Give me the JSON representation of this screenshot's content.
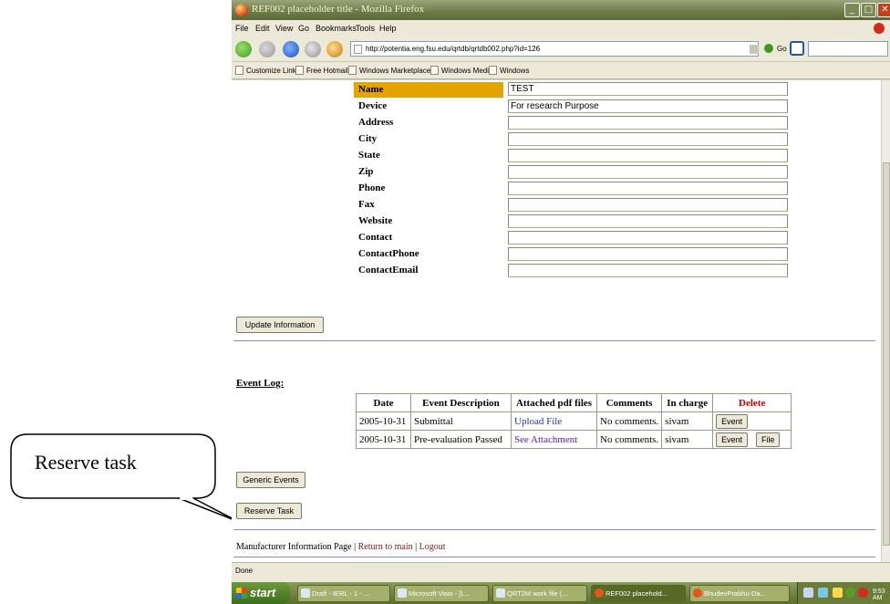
{
  "callout": {
    "text": "Reserve task"
  },
  "window": {
    "title": "REF002 placeholder title - Mozilla Firefox",
    "controls": {
      "minimize": "_",
      "maximize": "□",
      "close": "✕"
    }
  },
  "menu": [
    "File",
    "Edit",
    "View",
    "Go",
    "Bookmarks",
    "Tools",
    "Help"
  ],
  "nav": {
    "url": "http://potentia.eng.fsu.edu/qrtdb/qrtdb002.php?id=126",
    "go_label": "Go"
  },
  "bookmarks": [
    "Customize Links",
    "Free Hotmail",
    "Windows Marketplace",
    "Windows Media",
    "Windows"
  ],
  "info": {
    "fields": [
      {
        "label": "Name",
        "value": "TEST"
      },
      {
        "label": "Device",
        "value": "For research Purpose"
      },
      {
        "label": "Address",
        "value": ""
      },
      {
        "label": "City",
        "value": ""
      },
      {
        "label": "State",
        "value": ""
      },
      {
        "label": "Zip",
        "value": ""
      },
      {
        "label": "Phone",
        "value": ""
      },
      {
        "label": "Fax",
        "value": ""
      },
      {
        "label": "Website",
        "value": ""
      },
      {
        "label": "Contact",
        "value": ""
      },
      {
        "label": "ContactPhone",
        "value": ""
      },
      {
        "label": "ContactEmail",
        "value": ""
      }
    ],
    "update_button": "Update Information"
  },
  "event_log": {
    "title": "Event Log:",
    "headers": [
      "Date",
      "Event Description",
      "Attached pdf files",
      "Comments",
      "In charge",
      "Delete"
    ],
    "rows": [
      {
        "date": "2005-10-31",
        "description": "Submittal",
        "attachment": "Upload File",
        "comments": "No comments.",
        "in_charge": "sivam",
        "event_button": "Event",
        "file_button": ""
      },
      {
        "date": "2005-10-31",
        "description": "Pre-evaluation Passed",
        "attachment": "See Attachment",
        "comments": "No comments.",
        "in_charge": "sivam",
        "event_button": "Event",
        "file_button": "File"
      }
    ]
  },
  "buttons": {
    "generic_events": "Generic Events",
    "reserve_task": "Reserve Task"
  },
  "footer": {
    "page_name": "Manufacturer Information Page",
    "sep": "|",
    "return_main": "Return to main",
    "logout": "Logout"
  },
  "status": "Done",
  "taskbar": {
    "start": "start",
    "items": [
      "Draft - IERL - 1 - ...",
      "Microsoft Visio - [L...",
      "QRT2M work file (...",
      "REF002 placehold...",
      "BhudevPrabhu-Da..."
    ],
    "clock": "9:53 AM"
  }
}
